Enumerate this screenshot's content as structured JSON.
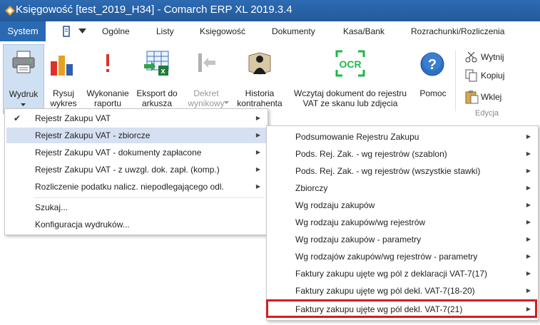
{
  "titlebar": {
    "title": "Księgowość [test_2019_H34] - Comarch ERP XL 2019.3.4"
  },
  "ribbon_tabs": {
    "system": "System",
    "tabs": [
      "Ogólne",
      "Listy",
      "Księgowość",
      "Dokumenty",
      "Kasa/Bank",
      "Rozrachunki/Rozliczenia"
    ]
  },
  "ribbon": {
    "buttons": [
      {
        "label": "Wydruk",
        "icon": "printer-icon"
      },
      {
        "label": "Rysuj\nwykres",
        "icon": "bar-chart-icon"
      },
      {
        "label": "Wykonanie\nraportu",
        "icon": "exclamation-icon"
      },
      {
        "label": "Eksport do\narkusza",
        "icon": "excel-export-icon"
      },
      {
        "label": "Dekret\nwynikowy",
        "icon": "decree-icon"
      },
      {
        "label": "Historia\nkontrahenta",
        "icon": "contractor-history-icon"
      },
      {
        "label": "Wczytaj dokument do rejestru\nVAT ze skanu lub zdjęcia",
        "icon": "ocr-icon",
        "ocr_text": "OCR"
      },
      {
        "label": "Pomoc",
        "icon": "help-icon",
        "help_glyph": "?"
      }
    ],
    "edit_group": {
      "cut": "Wytnij",
      "copy": "Kopiuj",
      "paste": "Wklej",
      "label": "Edycja"
    }
  },
  "menu": {
    "items": [
      "Rejestr Zakupu VAT",
      "Rejestr Zakupu VAT - zbiorcze",
      "Rejestr Zakupu VAT - dokumenty zapłacone",
      "Rejestr Zakupu VAT - z uwzgl. dok. zapł. (komp.)",
      "Rozliczenie podatku nalicz. niepodlegającego odl.",
      "Szukaj...",
      "Konfiguracja wydruków..."
    ],
    "checkmark": "✔",
    "arrow": "▶"
  },
  "submenu": {
    "items": [
      "Podsumowanie Rejestru Zakupu",
      "Pods. Rej. Zak. - wg rejestrów (szablon)",
      "Pods. Rej. Zak. - wg rejestrów (wszystkie stawki)",
      "Zbiorczy",
      "Wg rodzaju zakupów",
      "Wg rodzaju zakupów/wg rejestrów",
      "Wg rodzaju zakupów - parametry",
      "Wg rodzajów zakupów/wg rejestrów - parametry",
      "Faktury zakupu ujęte wg pól z deklaracji VAT-7(17)",
      "Faktury zakupu ujęte wg pól dekl. VAT-7(18-20)",
      "Faktury zakupu ujęte wg pól dekl. VAT-7(21)"
    ]
  },
  "colors": {
    "accent": "#2a6ab3",
    "highlight_border": "#d21f1f",
    "menu_highlight": "#d5e1f2"
  }
}
